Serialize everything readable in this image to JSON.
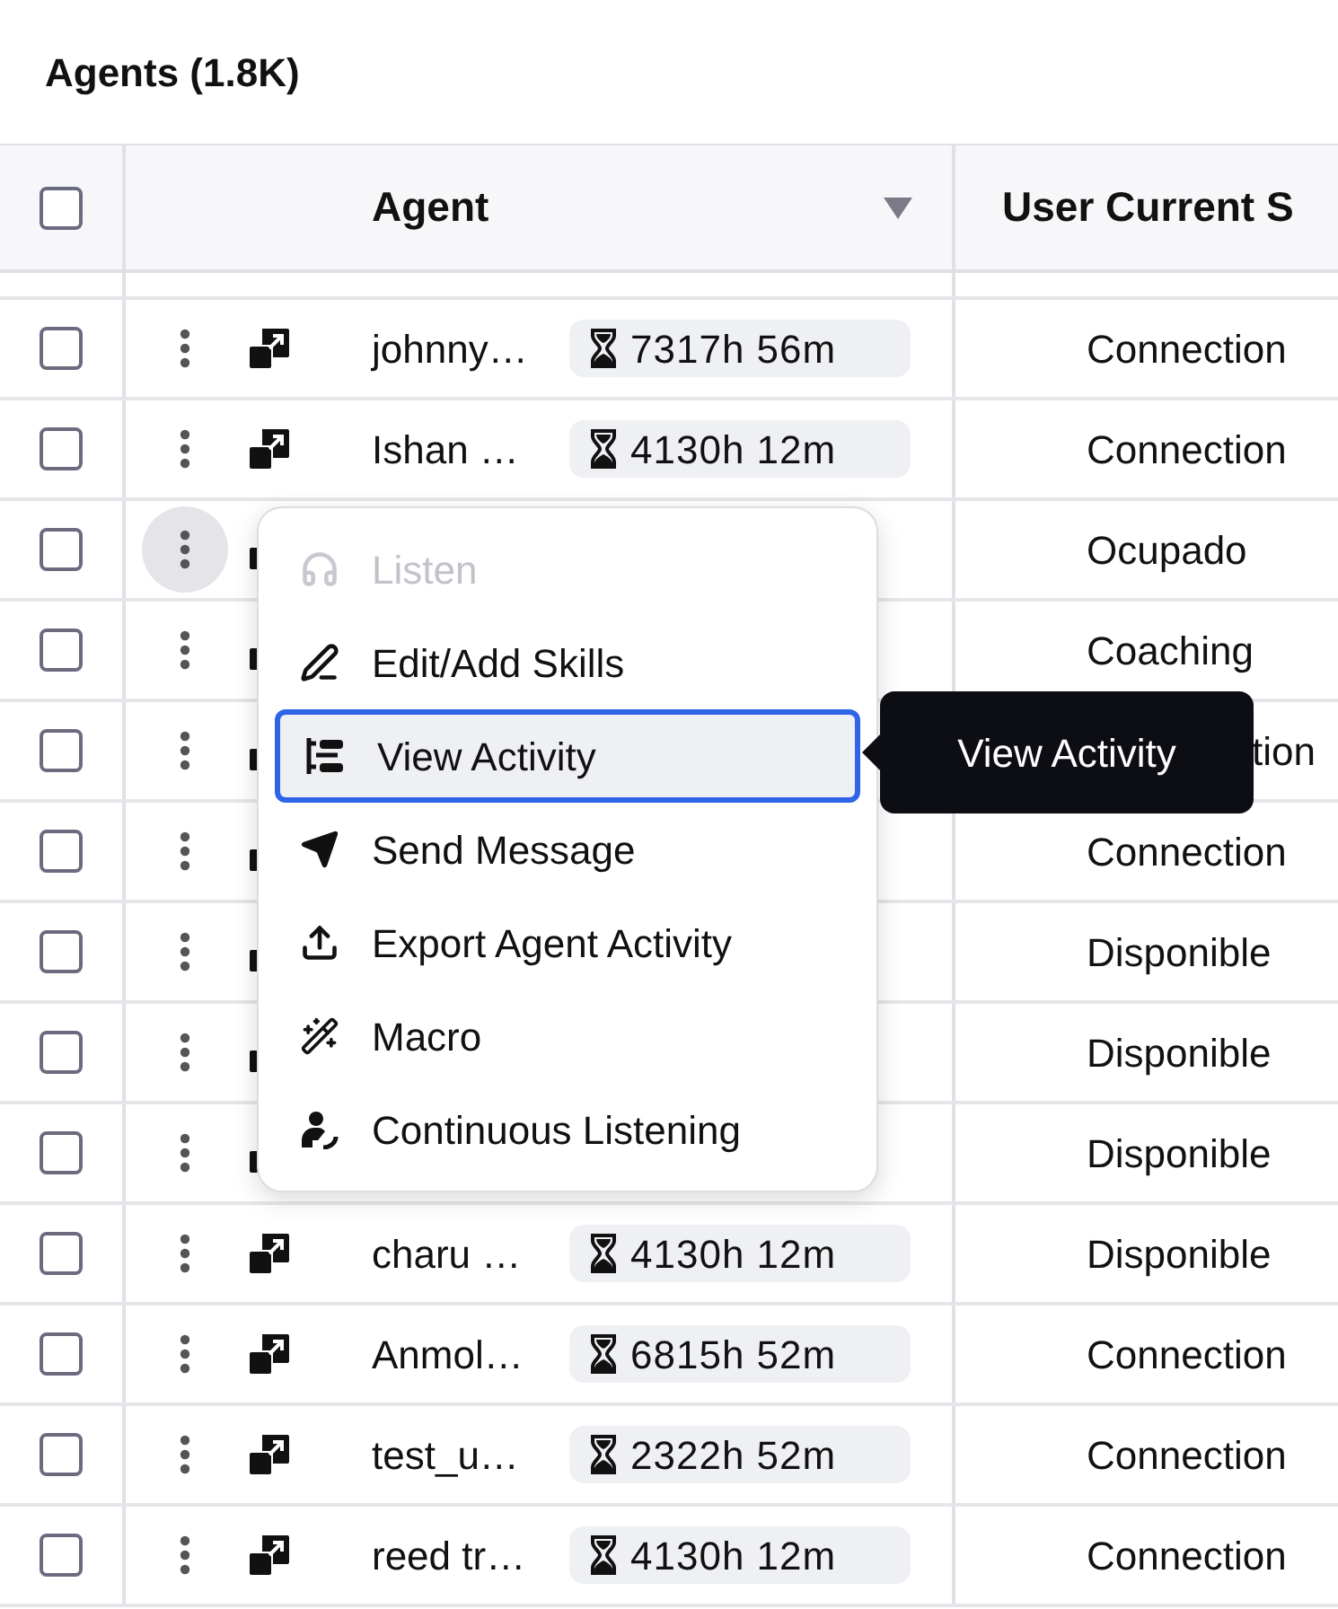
{
  "title": "Agents (1.8K)",
  "table": {
    "columns": [
      "Agent",
      "User Current S"
    ],
    "select_all_checked": false,
    "rows": [
      {
        "checked": false,
        "menu_open": false,
        "name": "johnny…",
        "duration": "7317h 56m",
        "status": "Connection",
        "status_clipped": false
      },
      {
        "checked": false,
        "menu_open": false,
        "name": "Ishan …",
        "duration": "4130h 12m",
        "status": "Connection",
        "status_clipped": false
      },
      {
        "checked": false,
        "menu_open": true,
        "status": "Ocupado",
        "status_clipped": false
      },
      {
        "checked": false,
        "menu_open": false,
        "status": "Coaching",
        "status_clipped": false
      },
      {
        "checked": false,
        "menu_open": false,
        "status": "tion",
        "status_clipped": true
      },
      {
        "checked": false,
        "menu_open": false,
        "status": "Connection",
        "status_clipped": false
      },
      {
        "checked": false,
        "menu_open": false,
        "status": "Disponible",
        "status_clipped": false
      },
      {
        "checked": false,
        "menu_open": false,
        "status": "Disponible",
        "status_clipped": false
      },
      {
        "checked": false,
        "menu_open": false,
        "status": "Disponible",
        "status_clipped": false
      },
      {
        "checked": false,
        "menu_open": false,
        "name": "charu …",
        "duration": "4130h 12m",
        "status": "Disponible",
        "status_clipped": false
      },
      {
        "checked": false,
        "menu_open": false,
        "name": "Anmol…",
        "duration": "6815h 52m",
        "status": "Connection",
        "status_clipped": false
      },
      {
        "checked": false,
        "menu_open": false,
        "name": "test_u…",
        "duration": "2322h 52m",
        "status": "Connection",
        "status_clipped": false
      },
      {
        "checked": false,
        "menu_open": false,
        "name": "reed tr…",
        "duration": "4130h 12m",
        "status": "Connection",
        "status_clipped": false
      }
    ]
  },
  "menu": {
    "items": [
      {
        "kind": "listen",
        "label": "Listen",
        "disabled": true,
        "selected": false
      },
      {
        "kind": "skills",
        "label": "Edit/Add Skills",
        "disabled": false,
        "selected": false
      },
      {
        "kind": "activity",
        "label": "View Activity",
        "disabled": false,
        "selected": true
      },
      {
        "kind": "message",
        "label": "Send Message",
        "disabled": false,
        "selected": false
      },
      {
        "kind": "export",
        "label": "Export Agent Activity",
        "disabled": false,
        "selected": false
      },
      {
        "kind": "macro",
        "label": "Macro",
        "disabled": false,
        "selected": false
      },
      {
        "kind": "continuous",
        "label": "Continuous Listening",
        "disabled": false,
        "selected": false
      }
    ]
  },
  "tooltip": "View Activity"
}
